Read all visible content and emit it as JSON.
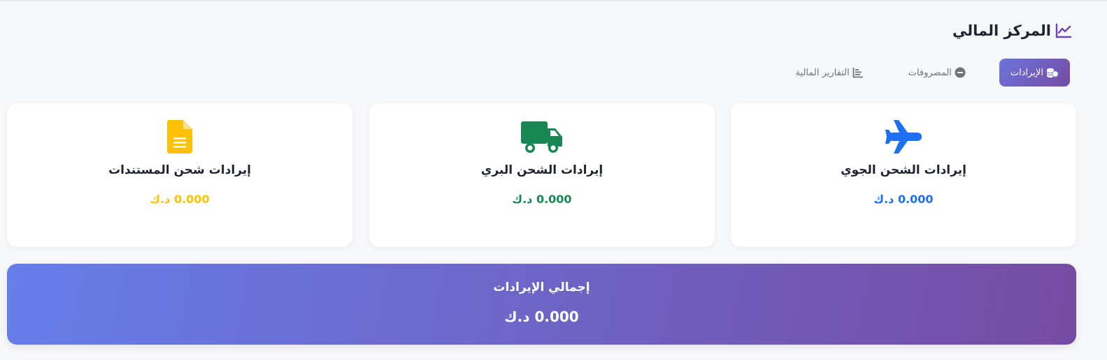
{
  "header": {
    "title": "المركز المالي",
    "icon": "chart-line-icon",
    "icon_color": "#6f42c1"
  },
  "tabs": [
    {
      "label": "الإيرادات",
      "icon": "coins-icon",
      "active": true
    },
    {
      "label": "المصروفات",
      "icon": "minus-circle-icon",
      "active": false
    },
    {
      "label": "التقارير المالية",
      "icon": "report-chart-icon",
      "active": false
    }
  ],
  "cards": [
    {
      "label": "إيرادات الشحن الجوي",
      "amount": "0.000 د.ك",
      "icon": "airplane-icon",
      "color": "#1f6ff2"
    },
    {
      "label": "إيرادات الشحن البري",
      "amount": "0.000 د.ك",
      "icon": "truck-icon",
      "color": "#198754"
    },
    {
      "label": "إيرادات شحن المستندات",
      "amount": "0.000 د.ك",
      "icon": "document-icon",
      "color": "#ffc107"
    }
  ],
  "total": {
    "label": "إجمالي الإيرادات",
    "amount": "0.000 د.ك"
  },
  "colors": {
    "gradient_start": "#667eea",
    "gradient_end": "#764ba2"
  }
}
